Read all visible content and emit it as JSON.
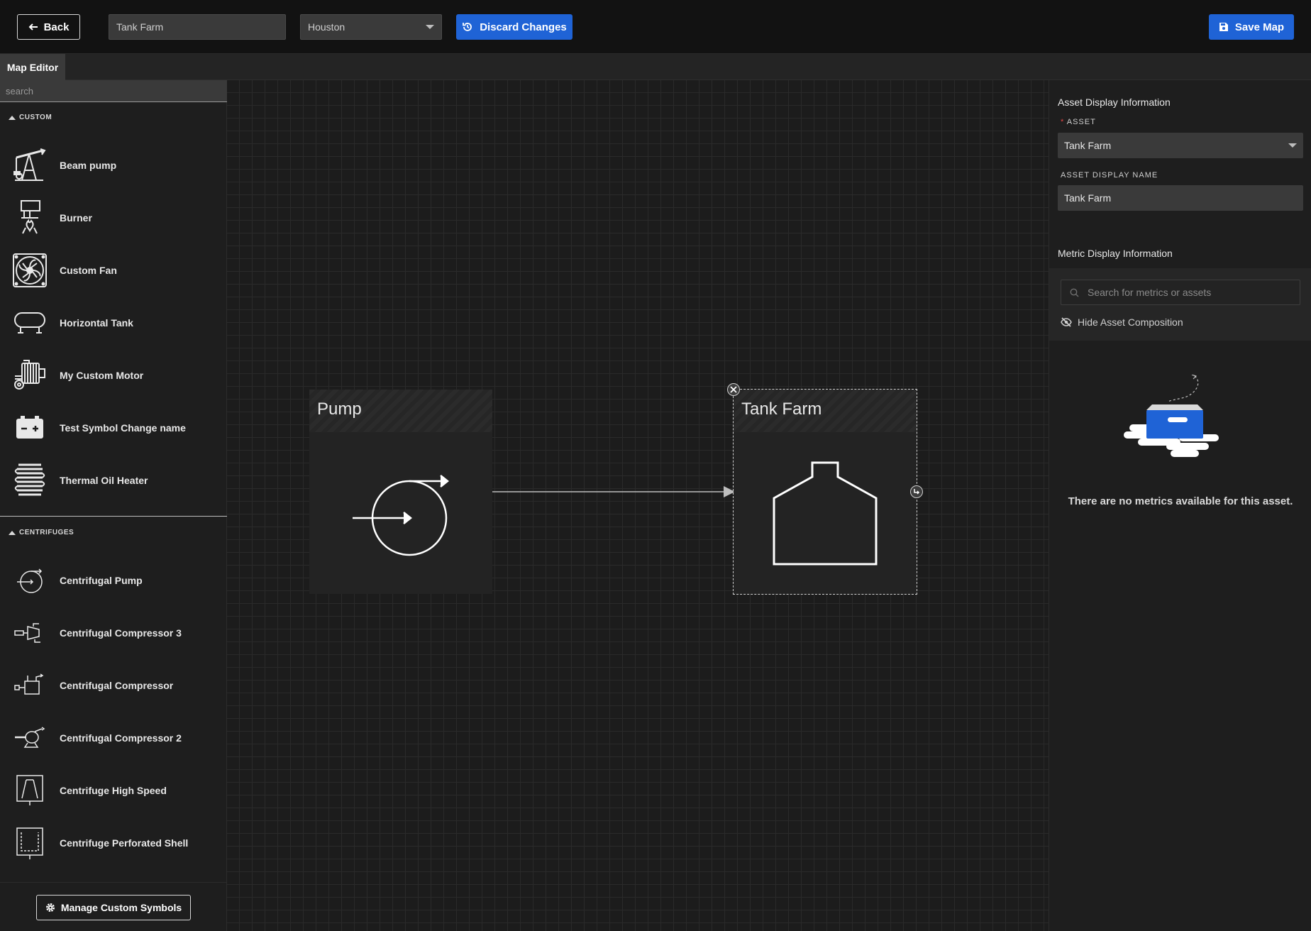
{
  "topbar": {
    "back_label": "Back",
    "map_name": "Tank Farm",
    "location": "Houston",
    "discard_label": "Discard Changes",
    "save_label": "Save Map"
  },
  "tabs": [
    {
      "label": "Map Editor"
    }
  ],
  "palette": {
    "search_placeholder": "search",
    "sections": [
      {
        "title": "CUSTOM",
        "items": [
          {
            "label": "Beam pump",
            "icon": "beam-pump-icon"
          },
          {
            "label": "Burner",
            "icon": "burner-icon"
          },
          {
            "label": "Custom Fan",
            "icon": "fan-icon"
          },
          {
            "label": "Horizontal Tank",
            "icon": "horizontal-tank-icon"
          },
          {
            "label": "My Custom Motor",
            "icon": "motor-icon"
          },
          {
            "label": "Test Symbol Change name",
            "icon": "battery-icon"
          },
          {
            "label": "Thermal Oil Heater",
            "icon": "heater-icon"
          }
        ]
      },
      {
        "title": "CENTRIFUGES",
        "items": [
          {
            "label": "Centrifugal Pump",
            "icon": "centrifugal-pump-icon"
          },
          {
            "label": "Centrifugal Compressor 3",
            "icon": "compressor-icon"
          },
          {
            "label": "Centrifugal Compressor",
            "icon": "compressor-icon"
          },
          {
            "label": "Centrifugal Compressor 2",
            "icon": "compressor-icon"
          },
          {
            "label": "Centrifuge High Speed",
            "icon": "centrifuge-icon"
          },
          {
            "label": "Centrifuge Perforated Shell",
            "icon": "centrifuge-icon"
          }
        ]
      }
    ],
    "manage_label": "Manage Custom Symbols"
  },
  "canvas": {
    "nodes": [
      {
        "title": "Pump",
        "icon": "centrifugal-pump-icon",
        "selected": false
      },
      {
        "title": "Tank Farm",
        "icon": "tank-icon",
        "selected": true
      }
    ]
  },
  "right_panel": {
    "asset_section_title": "Asset Display Information",
    "asset_label": "ASSET",
    "asset_required_mark": "*",
    "asset_value": "Tank Farm",
    "display_name_label": "ASSET DISPLAY NAME",
    "display_name_value": "Tank Farm",
    "metric_section_title": "Metric Display Information",
    "metric_search_placeholder": "Search for metrics or assets",
    "hide_composition_label": "Hide Asset Composition",
    "empty_message": "There are no metrics available for this asset."
  },
  "colors": {
    "accent": "#1f63d6",
    "background": "#1a1a1a",
    "required": "#e04545"
  }
}
